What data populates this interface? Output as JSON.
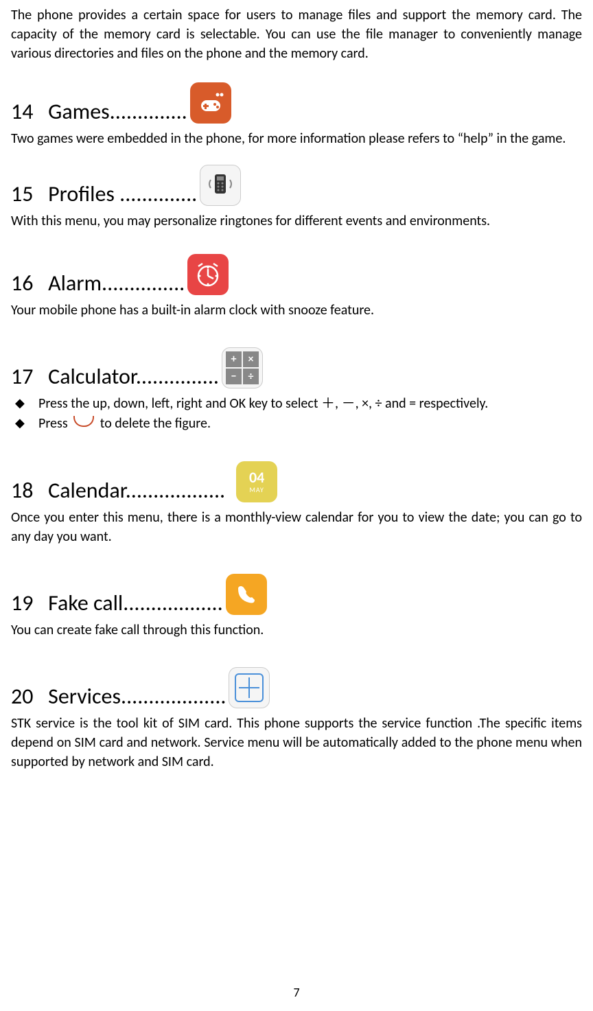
{
  "intro_paragraph": "The phone provides a certain space for users to manage files and support the memory card. The capacity of the memory card is selectable. You can use the file manager to conveniently manage various directories and files on the phone and the memory card.",
  "sections": {
    "games": {
      "number": "14",
      "title": "Games..............",
      "body": "Two games were embedded in the phone, for more information please refers to “help” in the game."
    },
    "profiles": {
      "number": "15",
      "title": "Profiles ..............",
      "body": "With this menu, you may personalize ringtones for different events and environments."
    },
    "alarm": {
      "number": "16",
      "title": "Alarm...............",
      "body": "Your mobile phone has a built-in alarm clock with snooze feature."
    },
    "calculator": {
      "number": "17",
      "title": "Calculator...............",
      "bullet1": "Press the up, down, left, right and OK key to select ＋, －, ×, ÷ and = respectively.",
      "bullet2a": "Press ",
      "bullet2b": " to delete the figure."
    },
    "calendar": {
      "number": "18",
      "title": "Calendar..................",
      "body": "Once you enter this menu, there is a monthly-view calendar for you to view the date; you can go to any day you want.",
      "icon_num": "04",
      "icon_month": "MAY"
    },
    "fakecall": {
      "number": "19",
      "title": "Fake call..................",
      "body": "You can create fake call through this function."
    },
    "services": {
      "number": "20",
      "title": "Services...................",
      "body": "STK service is the tool kit of SIM card. This phone supports the service function .The specific items depend on SIM card and network. Service menu will be automatically added to the phone menu when supported by network and SIM card."
    }
  },
  "page_number": "7"
}
